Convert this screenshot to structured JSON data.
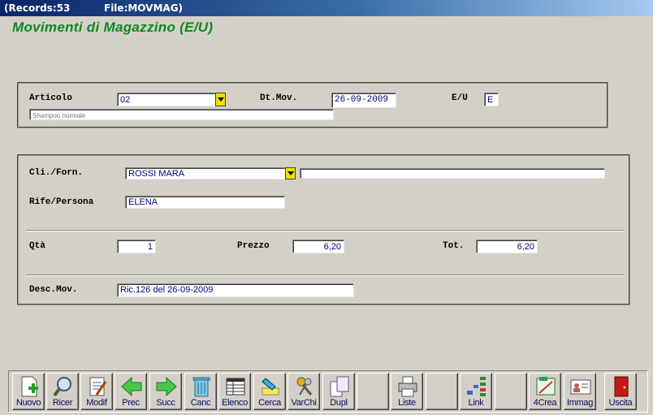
{
  "window": {
    "records": "(Records:53",
    "file": "File:MOVMAG)"
  },
  "form_title": "Movimenti di Magazzino  (E/U)",
  "articolo": {
    "label": "Articolo",
    "code": "02",
    "description": "Shampoo normale"
  },
  "dt_mov": {
    "label": "Dt.Mov.",
    "value": "26-09-2009"
  },
  "eu": {
    "label": "E/U",
    "value": "E"
  },
  "cli_forn": {
    "label": "Cli./Forn.",
    "value": "ROSSI MARA",
    "extra": ""
  },
  "rife": {
    "label": "Rife/Persona",
    "value": "ELENA"
  },
  "qta": {
    "label": "Qtà",
    "value": "1"
  },
  "prezzo": {
    "label": "Prezzo",
    "value": "6,20"
  },
  "tot": {
    "label": "Tot.",
    "value": "6,20"
  },
  "desc_mov": {
    "label": "Desc.Mov.",
    "value": "Ric.126 del 26-09-2009"
  },
  "toolbar": {
    "nuovo": "Nuovo",
    "ricer": "Ricer",
    "modif": "Modif",
    "prec": "Prec",
    "succ": "Succ",
    "canc": "Canc",
    "elenco": "Elenco",
    "cerca": "Cerca",
    "varchi": "VarChi",
    "dupl": "Dupl",
    "liste": "Liste",
    "link": "Link",
    "crea": "4Crea",
    "immag": "Immag",
    "uscita": "Uscita"
  },
  "colors": {
    "title_green": "#0b8a1f",
    "field_text": "#00007a",
    "dropdown_yellow": "#f0e000",
    "window_bg": "#d4d0c8"
  },
  "icons": [
    "new-doc-icon",
    "search-magnifier-icon",
    "edit-doc-icon",
    "arrow-left-icon",
    "arrow-right-icon",
    "trash-icon",
    "table-icon",
    "highlight-icon",
    "keys-icon",
    "copy-doc-icon",
    "printer-icon",
    "tree-icon",
    "create-icon",
    "id-card-icon",
    "exit-door-icon"
  ]
}
